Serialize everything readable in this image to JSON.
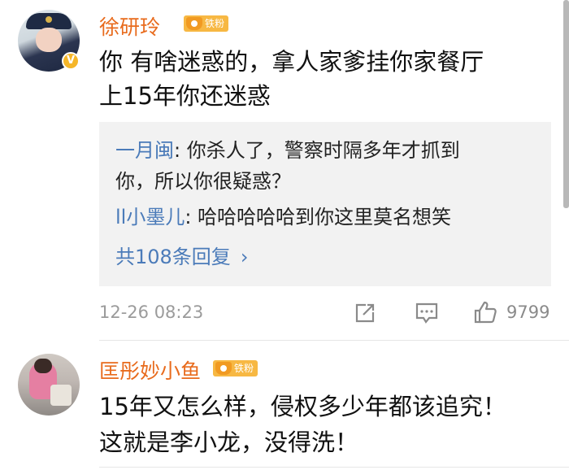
{
  "comments": [
    {
      "username": "徐研玲",
      "fan_badge": "铁粉",
      "text_lines": [
        "你 有啥迷惑的，拿人家爹挂你家餐厅",
        "上15年你还迷惑"
      ],
      "replies": [
        {
          "name": "一月闽",
          "text_lines": [
            ": 你杀人了，警察时隔多年才抓到",
            "你，所以你很疑惑？"
          ]
        },
        {
          "name": "ll小墨儿",
          "text_lines": [
            ": 哈哈哈哈哈到你这里莫名想笑"
          ]
        }
      ],
      "more_replies": "共108条回复",
      "more_icon": "chevron-right-icon",
      "timestamp": "12-26 08:23",
      "like_count": "9799",
      "icons": [
        "share-icon",
        "comment-icon",
        "like-icon"
      ]
    },
    {
      "username": "匡彤妙小鱼",
      "fan_badge": "铁粉",
      "text_lines": [
        "15年又怎么样，侵权多少年都该追究！",
        "这就是李小龙，没得洗！"
      ]
    }
  ],
  "colors": {
    "username": "#e86b1d",
    "reply_name": "#4b7bb9",
    "badge": "#f7b843",
    "reply_bg": "#f2f2f2"
  }
}
